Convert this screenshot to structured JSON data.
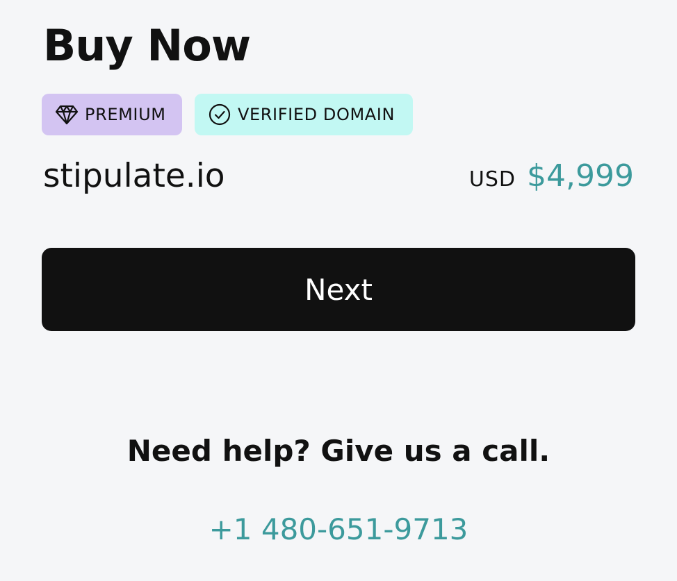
{
  "header": {
    "title": "Buy Now"
  },
  "badges": [
    {
      "label": "PREMIUM",
      "icon": "diamond-icon",
      "color": "#d3c4f2"
    },
    {
      "label": "VERIFIED DOMAIN",
      "icon": "check-circle-icon",
      "color": "#c2f8f3"
    }
  ],
  "listing": {
    "domain": "stipulate.io",
    "currency": "USD",
    "price": "$4,999",
    "price_color": "#3c9a9c"
  },
  "actions": {
    "next_label": "Next"
  },
  "help": {
    "text": "Need help? Give us a call.",
    "phone": "+1 480-651-9713"
  },
  "colors": {
    "background": "#f5f6f8",
    "button": "#111111",
    "accent": "#3c9a9c"
  }
}
